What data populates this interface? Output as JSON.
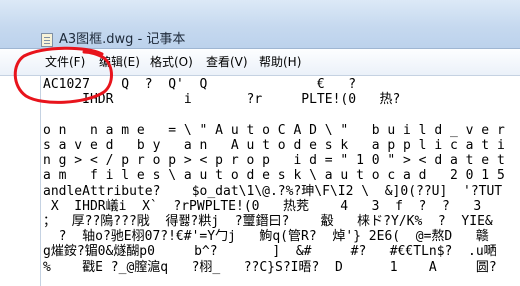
{
  "window": {
    "title": "A3图框.dwg - 记事本"
  },
  "menu": {
    "items": [
      "文件(F)",
      "编辑(E)",
      "格式(O)",
      "查看(V)",
      "帮助(H)"
    ]
  },
  "annotation": {
    "color": "#e8141c"
  },
  "document": {
    "lines": [
      "AC1027    Q  ?  Q'  Q              €   ?",
      "     IHDR         i       ?r     PLTE!(0   热?",
      "",
      "o n   n a m e   = \\ \" A u t o C A D \\ \"   b u i l d _ v e r",
      "s a v e d   b y   a n   A u t o d e s k   a p p l i c a t i",
      "n g > < / p r o p > < p r o p   i d = \" 1 0 \" > < d a t e t",
      "a m   f i l e s \\ a u t o d e s k \\ a u t o c a d   2 0 1 5",
      "andleAttribute?    $o_dat\\1\\@.?%?珅\\F\\I2 \\  &]0(??U]  '?TUT",
      " X  IHDR嶬i  X`  ?rPWPLTE!(0   热茺    4   3  f  ?  ?   3",
      "；  厚??隝???戙  得퐳?粠j  ?璽鐕曰?    觳   梾ド?Y/K%  ?  YIE&",
      "  ?  轴o?驰E栩07?!€#'=Y勹j   鮈q(管R?  焯'} 2E6(  @=熬D   赣",
      "g熣銨?镅0&燧醐p0     b^?       ]  &#     #?   #€€TLn$?  .u嗮",
      "%    戳E ?_@膣滬q   ?栩_   ??C}S?I晤?  D      1    A     圆?"
    ]
  }
}
